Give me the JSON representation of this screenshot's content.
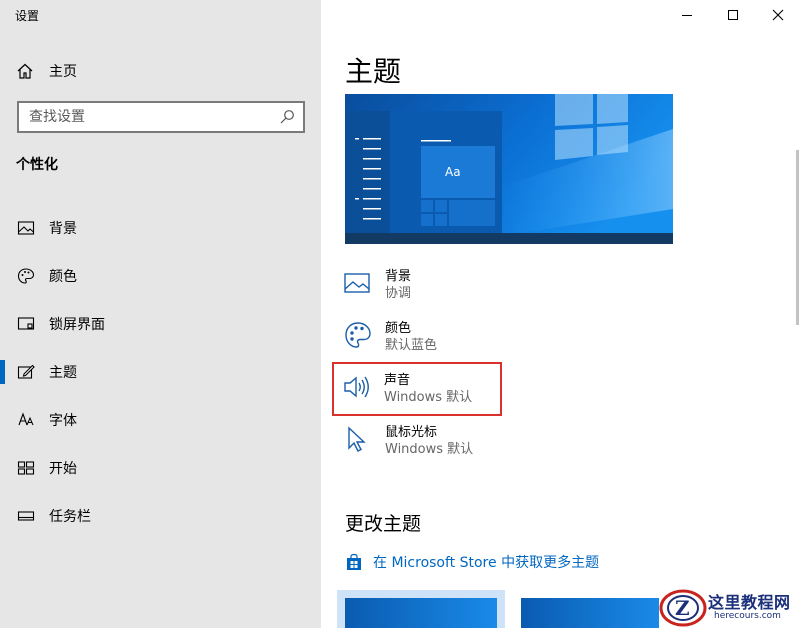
{
  "window": {
    "title": "设置"
  },
  "sidebar": {
    "home_label": "主页",
    "search_placeholder": "查找设置",
    "section": "个性化",
    "items": [
      {
        "label": "背景",
        "icon": "picture-icon",
        "active": false
      },
      {
        "label": "颜色",
        "icon": "palette-icon",
        "active": false
      },
      {
        "label": "锁屏界面",
        "icon": "lock-screen-icon",
        "active": false
      },
      {
        "label": "主题",
        "icon": "theme-edit-icon",
        "active": true
      },
      {
        "label": "字体",
        "icon": "font-icon",
        "active": false
      },
      {
        "label": "开始",
        "icon": "start-tiles-icon",
        "active": false
      },
      {
        "label": "任务栏",
        "icon": "taskbar-icon",
        "active": false
      }
    ]
  },
  "main": {
    "title": "主题",
    "preview_text": "Aa",
    "options": [
      {
        "title": "背景",
        "subtitle": "协调",
        "icon": "picture-icon"
      },
      {
        "title": "颜色",
        "subtitle": "默认蓝色",
        "icon": "palette-icon"
      },
      {
        "title": "声音",
        "subtitle": "Windows 默认",
        "icon": "speaker-icon",
        "highlighted": true
      },
      {
        "title": "鼠标光标",
        "subtitle": "Windows 默认",
        "icon": "cursor-icon"
      }
    ],
    "change_theme_title": "更改主题",
    "store_link": "在 Microsoft Store 中获取更多主题"
  },
  "watermark": {
    "title": "这里教程网",
    "url": "herecours.com"
  },
  "colors": {
    "accent": "#0067c0",
    "highlight_border": "#d9312e",
    "sidebar_bg": "#e6e6e6"
  }
}
